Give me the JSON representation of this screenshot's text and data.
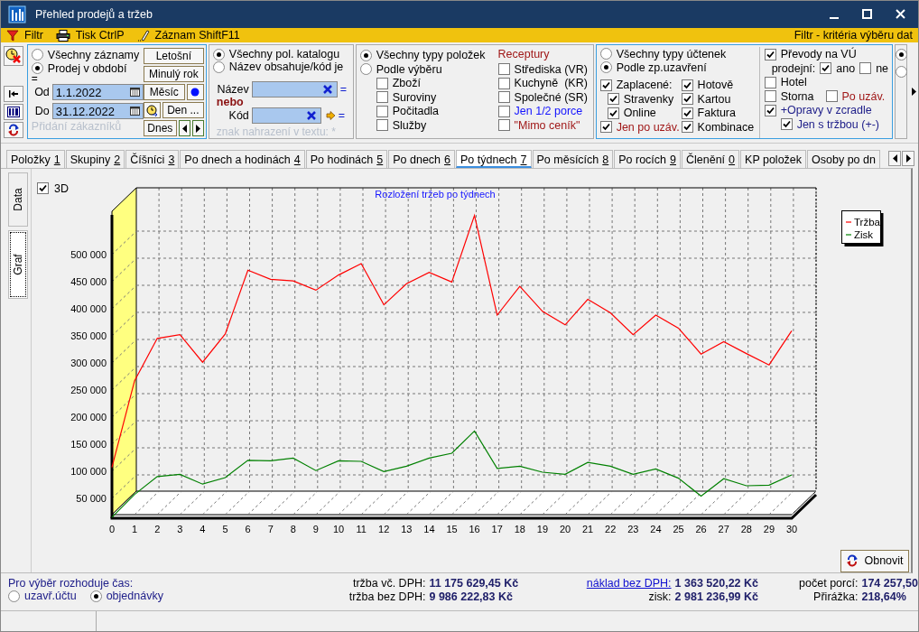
{
  "window": {
    "title": "Přehled prodejů a tržeb"
  },
  "toolbar": {
    "items": [
      {
        "kind": "filter",
        "label": "Filtr"
      },
      {
        "kind": "print",
        "label": "Tisk CtrlP"
      },
      {
        "kind": "record",
        "label": "Záznam ShiftF11"
      }
    ],
    "caption": "Filtr - kritéria výběru dat"
  },
  "period": {
    "options": [
      {
        "label": "Všechny záznamy",
        "selected": false
      },
      {
        "label": "Prodej v období",
        "selected": true
      }
    ],
    "eq": "=",
    "from_label": "Od",
    "from": "1.1.2022",
    "to_label": "Do",
    "to": "31.12.2022",
    "note": "Přidání zákazníků",
    "buttons": {
      "this_year": "Letošní",
      "last_year": "Minulý rok",
      "month": "Měsíc",
      "day": "Den ...",
      "today": "Dnes"
    }
  },
  "catalog": {
    "options": [
      {
        "label": "Všechny pol. katalogu",
        "selected": true
      },
      {
        "label": "Název obsahuje/kód je",
        "selected": false
      }
    ],
    "name_label": "Název",
    "or_label": "nebo",
    "code_label": "Kód",
    "eq": "=",
    "hint": "znak nahrazení v textu: *"
  },
  "item_types": {
    "options": [
      {
        "label": "Všechny typy položek",
        "selected": true
      },
      {
        "label": "Podle výběru",
        "selected": false
      }
    ],
    "types": [
      {
        "label": "Zboží",
        "checked": false
      },
      {
        "label": "Suroviny",
        "checked": false
      },
      {
        "label": "Počitadla",
        "checked": false
      },
      {
        "label": "Služby",
        "checked": false
      }
    ],
    "recipes_title": "Receptury",
    "recipes": [
      {
        "label": "Střediska (VR)",
        "checked": false,
        "color": "#000000"
      },
      {
        "label": "Kuchyně  (KR)",
        "checked": false,
        "color": "#000000"
      },
      {
        "label": "Společné (SR)",
        "checked": false,
        "color": "#000000"
      },
      {
        "label": "Jen 1/2 porce",
        "checked": false,
        "color": "#1414ff"
      },
      {
        "label": "\"Mimo ceník\"",
        "checked": false,
        "color": "#a01818"
      }
    ]
  },
  "receipts": {
    "options": [
      {
        "label": "Všechny typy účtenek",
        "selected": false
      },
      {
        "label": "Podle zp.uzavření",
        "selected": true
      }
    ],
    "paid": {
      "label": "Zaplacené:",
      "checked": true
    },
    "paid_left": [
      {
        "label": "Stravenky",
        "checked": true
      },
      {
        "label": "Online",
        "checked": true
      }
    ],
    "after_close": {
      "label": "Jen po uzáv.",
      "checked": true
    },
    "paid_right": [
      {
        "label": "Hotově",
        "checked": true
      },
      {
        "label": "Kartou",
        "checked": true
      },
      {
        "label": "Faktura",
        "checked": true
      },
      {
        "label": "Kombinace",
        "checked": true
      }
    ]
  },
  "transfers": {
    "label": "Převody na VÚ",
    "label_2": "prodejní:",
    "checked": true,
    "yes": {
      "label": "ano",
      "checked": true
    },
    "no": {
      "label": "ne",
      "checked": false
    },
    "hotel": {
      "label": "Hotel",
      "checked": false
    },
    "storno": {
      "label": "Storna",
      "checked": false
    },
    "storno_after": {
      "label": "Po uzáv.",
      "checked": false
    },
    "corrections": {
      "label": "+Opravy v zcradle",
      "checked": true
    },
    "revenue_only": {
      "label": "Jen s tržbou (+-)",
      "checked": true
    }
  },
  "next_panel_radios": [
    {
      "selected": true
    },
    {
      "selected": false
    }
  ],
  "tabs": [
    {
      "label": "Položky",
      "key": "1",
      "selected": false
    },
    {
      "label": "Skupiny",
      "key": "2",
      "selected": false
    },
    {
      "label": "Číšníci",
      "key": "3",
      "selected": false
    },
    {
      "label": "Po dnech a hodinách",
      "key": "4",
      "selected": false
    },
    {
      "label": "Po hodinách",
      "key": "5",
      "selected": false
    },
    {
      "label": "Po dnech",
      "key": "6",
      "selected": false
    },
    {
      "label": "Po týdnech",
      "key": "7",
      "selected": true
    },
    {
      "label": "Po měsících",
      "key": "8",
      "selected": false
    },
    {
      "label": "Po rocích",
      "key": "9",
      "selected": false
    },
    {
      "label": "Členění",
      "key": "0",
      "selected": false
    },
    {
      "label": "KP položek",
      "selected": false
    },
    {
      "label": "Osoby po dn",
      "selected": false
    }
  ],
  "side_tabs": [
    {
      "label": "Data",
      "selected": false
    },
    {
      "label": "Graf",
      "selected": true
    }
  ],
  "show_3d": {
    "label": "3D",
    "checked": true
  },
  "chart": {
    "chart_data": {
      "type": "line",
      "title": "Rozložení tržeb po týdnech",
      "x": [
        0,
        1,
        2,
        3,
        4,
        5,
        6,
        7,
        8,
        9,
        10,
        11,
        12,
        13,
        14,
        15,
        16,
        17,
        18,
        19,
        20,
        21,
        22,
        23,
        24,
        25,
        26,
        27,
        28,
        29,
        30
      ],
      "series": [
        {
          "name": "Tržba",
          "color": "#ff0000",
          "values": [
            114000,
            274000,
            352000,
            359000,
            308000,
            360000,
            478000,
            461000,
            458000,
            441000,
            469000,
            490000,
            414000,
            453000,
            474000,
            456000,
            579000,
            395000,
            448000,
            402000,
            377000,
            424000,
            399000,
            359000,
            395000,
            371000,
            323000,
            346000,
            324000,
            303000,
            366000
          ]
        },
        {
          "name": "Zisk",
          "color": "#008000",
          "values": [
            22000,
            64000,
            97000,
            101000,
            83000,
            95000,
            127000,
            126000,
            131000,
            108000,
            126000,
            125000,
            106000,
            116000,
            131000,
            140000,
            181000,
            112000,
            116000,
            105000,
            101000,
            123000,
            116000,
            101000,
            111000,
            94000,
            61000,
            93000,
            80000,
            81000,
            100000
          ]
        }
      ],
      "xlim": [
        0,
        30
      ],
      "ylim": [
        20000,
        580000
      ],
      "grid": true,
      "legend": true,
      "xticks": [
        0,
        1,
        2,
        3,
        4,
        5,
        6,
        7,
        8,
        9,
        10,
        11,
        12,
        13,
        14,
        15,
        16,
        17,
        18,
        19,
        20,
        21,
        22,
        23,
        24,
        25,
        26,
        27,
        28,
        29,
        30
      ],
      "yticks": [
        {
          "value": 50000,
          "label": "50 000"
        },
        {
          "value": 100000,
          "label": "100 000"
        },
        {
          "value": 150000,
          "label": "150 000"
        },
        {
          "value": 200000,
          "label": "200 000"
        },
        {
          "value": 250000,
          "label": "250 000"
        },
        {
          "value": 300000,
          "label": "300 000"
        },
        {
          "value": 350000,
          "label": "350 000"
        },
        {
          "value": 400000,
          "label": "400 000"
        },
        {
          "value": 450000,
          "label": "450 000"
        },
        {
          "value": 500000,
          "label": "500 000"
        }
      ]
    }
  },
  "refresh_button": "Obnovit",
  "time_choice": {
    "label": "Pro výběr rozhoduje čas:",
    "options": [
      {
        "label": "uzavř.účtu",
        "selected": false
      },
      {
        "label": "objednávky",
        "selected": true
      }
    ]
  },
  "stats": [
    {
      "label": "tržba vč. DPH:",
      "value": "11 175 629,45 Kč",
      "kind": "text"
    },
    {
      "label": "tržba bez DPH:",
      "value": "9 986 222,83 Kč",
      "kind": "text"
    },
    {
      "label": "náklad bez DPH:",
      "value": "1 363 520,22 Kč",
      "kind": "link"
    },
    {
      "label": "zisk:",
      "value": "2 981 236,99 Kč",
      "kind": "text"
    },
    {
      "label": "počet porcí:",
      "value": "174 257,50",
      "kind": "text"
    },
    {
      "label": "Přirážka:",
      "value": "218,64%",
      "kind": "text"
    }
  ]
}
